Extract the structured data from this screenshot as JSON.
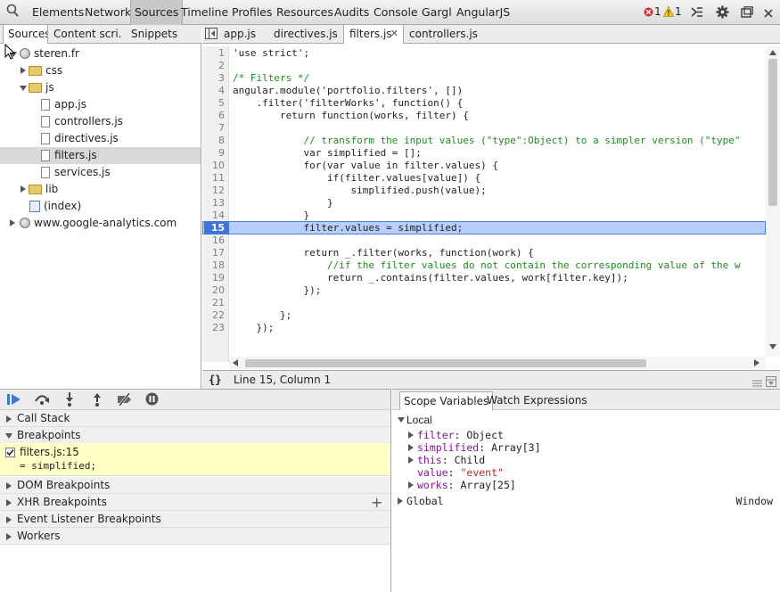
{
  "toolbar": {
    "tabs": [
      "Elements",
      "Network",
      "Sources",
      "Timeline",
      "Profiles",
      "Resources",
      "Audits",
      "Console",
      "Gargl",
      "AngularJS"
    ],
    "active": "Sources",
    "error_count": "1",
    "warning_count": "1"
  },
  "navigator": {
    "tabs": [
      "Sources",
      "Content scri...",
      "Snippets"
    ],
    "tree": [
      {
        "label": "steren.fr"
      },
      {
        "label": "css"
      },
      {
        "label": "js"
      },
      {
        "label": "app.js"
      },
      {
        "label": "controllers.js"
      },
      {
        "label": "directives.js"
      },
      {
        "label": "filters.js"
      },
      {
        "label": "services.js"
      },
      {
        "label": "lib"
      },
      {
        "label": "(index)"
      },
      {
        "label": "www.google-analytics.com"
      }
    ]
  },
  "editor": {
    "tabs": [
      "app.js",
      "directives.js",
      "filters.js",
      "controllers.js"
    ],
    "active_tab": "filters.js",
    "lines": [
      "'use strict';",
      "",
      "/* Filters */",
      "angular.module('portfolio.filters', [])",
      "    .filter('filterWorks', function() {",
      "        return function(works, filter) {",
      "",
      "            // transform the input values (\"type\":Object) to a simpler version (\"type\"",
      "            var simplified = [];",
      "            for(var value in filter.values) {",
      "                if(filter.values[value]) {",
      "                    simplified.push(value);",
      "                }",
      "            }",
      "            filter.values = simplified;",
      "",
      "            return _.filter(works, function(work) {",
      "                //if the filter values do not contain the corresponding value of the w",
      "                return _.contains(filter.values, work[filter.key]);",
      "            });",
      "",
      "        };",
      "    });"
    ],
    "line_numbers": [
      "1",
      "2",
      "3",
      "4",
      "5",
      "6",
      "7",
      "8",
      "9",
      "10",
      "11",
      "12",
      "13",
      "14",
      "15",
      "16",
      "17",
      "18",
      "19",
      "20",
      "21",
      "22",
      "23"
    ],
    "highlight_line": "15",
    "status": "Line 15, Column 1",
    "status_icon": "{}"
  },
  "debugger": {
    "sections": [
      "Call Stack",
      "Breakpoints",
      "DOM Breakpoints",
      "XHR Breakpoints",
      "Event Listener Breakpoints",
      "Workers"
    ],
    "breakpoint_file": "filters.js:15",
    "breakpoint_code": "= simplified;"
  },
  "scope": {
    "tabs": [
      "Scope Variables",
      "Watch Expressions"
    ],
    "local_label": "Local",
    "vars": [
      {
        "name": "filter",
        "value": "Object"
      },
      {
        "name": "simplified",
        "value": "Array[3]"
      },
      {
        "name": "this",
        "value": "Child"
      },
      {
        "name": "value",
        "value": "\"event\""
      },
      {
        "name": "works",
        "value": "Array[25]"
      }
    ],
    "global_label": "Global",
    "global_value": "Window"
  }
}
